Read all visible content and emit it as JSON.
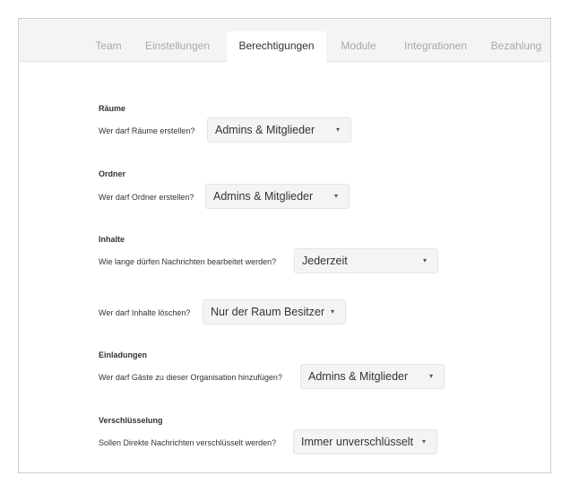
{
  "tabs": [
    {
      "label": "Team",
      "active": false
    },
    {
      "label": "Einstellungen",
      "active": false
    },
    {
      "label": "Berechtigungen",
      "active": true
    },
    {
      "label": "Module",
      "active": false
    },
    {
      "label": "Integrationen",
      "active": false
    },
    {
      "label": "Bezahlung",
      "active": false
    }
  ],
  "sections": {
    "rooms": {
      "title": "Räume",
      "question": "Wer darf Räume erstellen?",
      "value": "Admins & Mitglieder"
    },
    "folders": {
      "title": "Ordner",
      "question": "Wer darf Ordner erstellen?",
      "value": "Admins & Mitglieder"
    },
    "content": {
      "title": "Inhalte",
      "edit_question": "Wie lange dürfen Nachrichten bearbeitet werden?",
      "edit_value": "Jederzeit",
      "delete_question": "Wer darf Inhalte löschen?",
      "delete_value": "Nur der Raum Besitzer"
    },
    "invitations": {
      "title": "Einladungen",
      "question": "Wer darf Gäste zu dieser Organisation hinzufügen?",
      "value": "Admins & Mitglieder"
    },
    "encryption": {
      "title": "Verschlüsselung",
      "question": "Sollen Direkte Nachrichten verschlüsselt werden?",
      "value": "Immer unverschlüsselt"
    }
  },
  "icons": {
    "caret": "▾"
  }
}
